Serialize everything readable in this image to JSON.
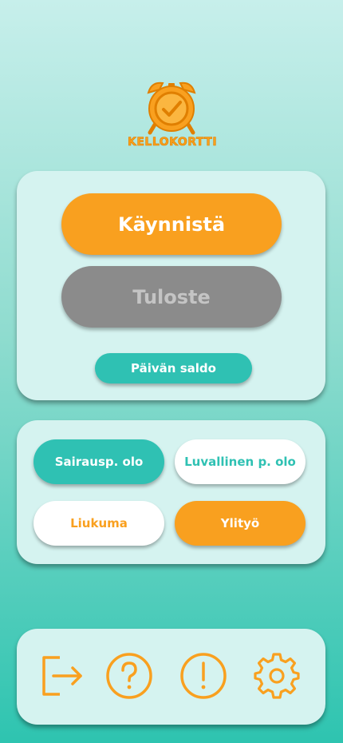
{
  "logo": {
    "text": "KELLOKORTTI"
  },
  "main": {
    "start_label": "Käynnistä",
    "print_label": "Tuloste",
    "day_balance_label": "Päivän saldo"
  },
  "absence": {
    "sick_label": "Sairausp. olo",
    "leave_label": "Luvallinen p. olo",
    "flex_label": "Liukuma",
    "overtime_label": "Ylityö"
  },
  "footer": {
    "icons": [
      "logout-icon",
      "help-icon",
      "alert-icon",
      "settings-icon"
    ]
  },
  "colors": {
    "orange": "#f9a01f",
    "teal": "#2fc1b3",
    "gray": "#8b8b8b",
    "card": "#d5f3f0"
  }
}
